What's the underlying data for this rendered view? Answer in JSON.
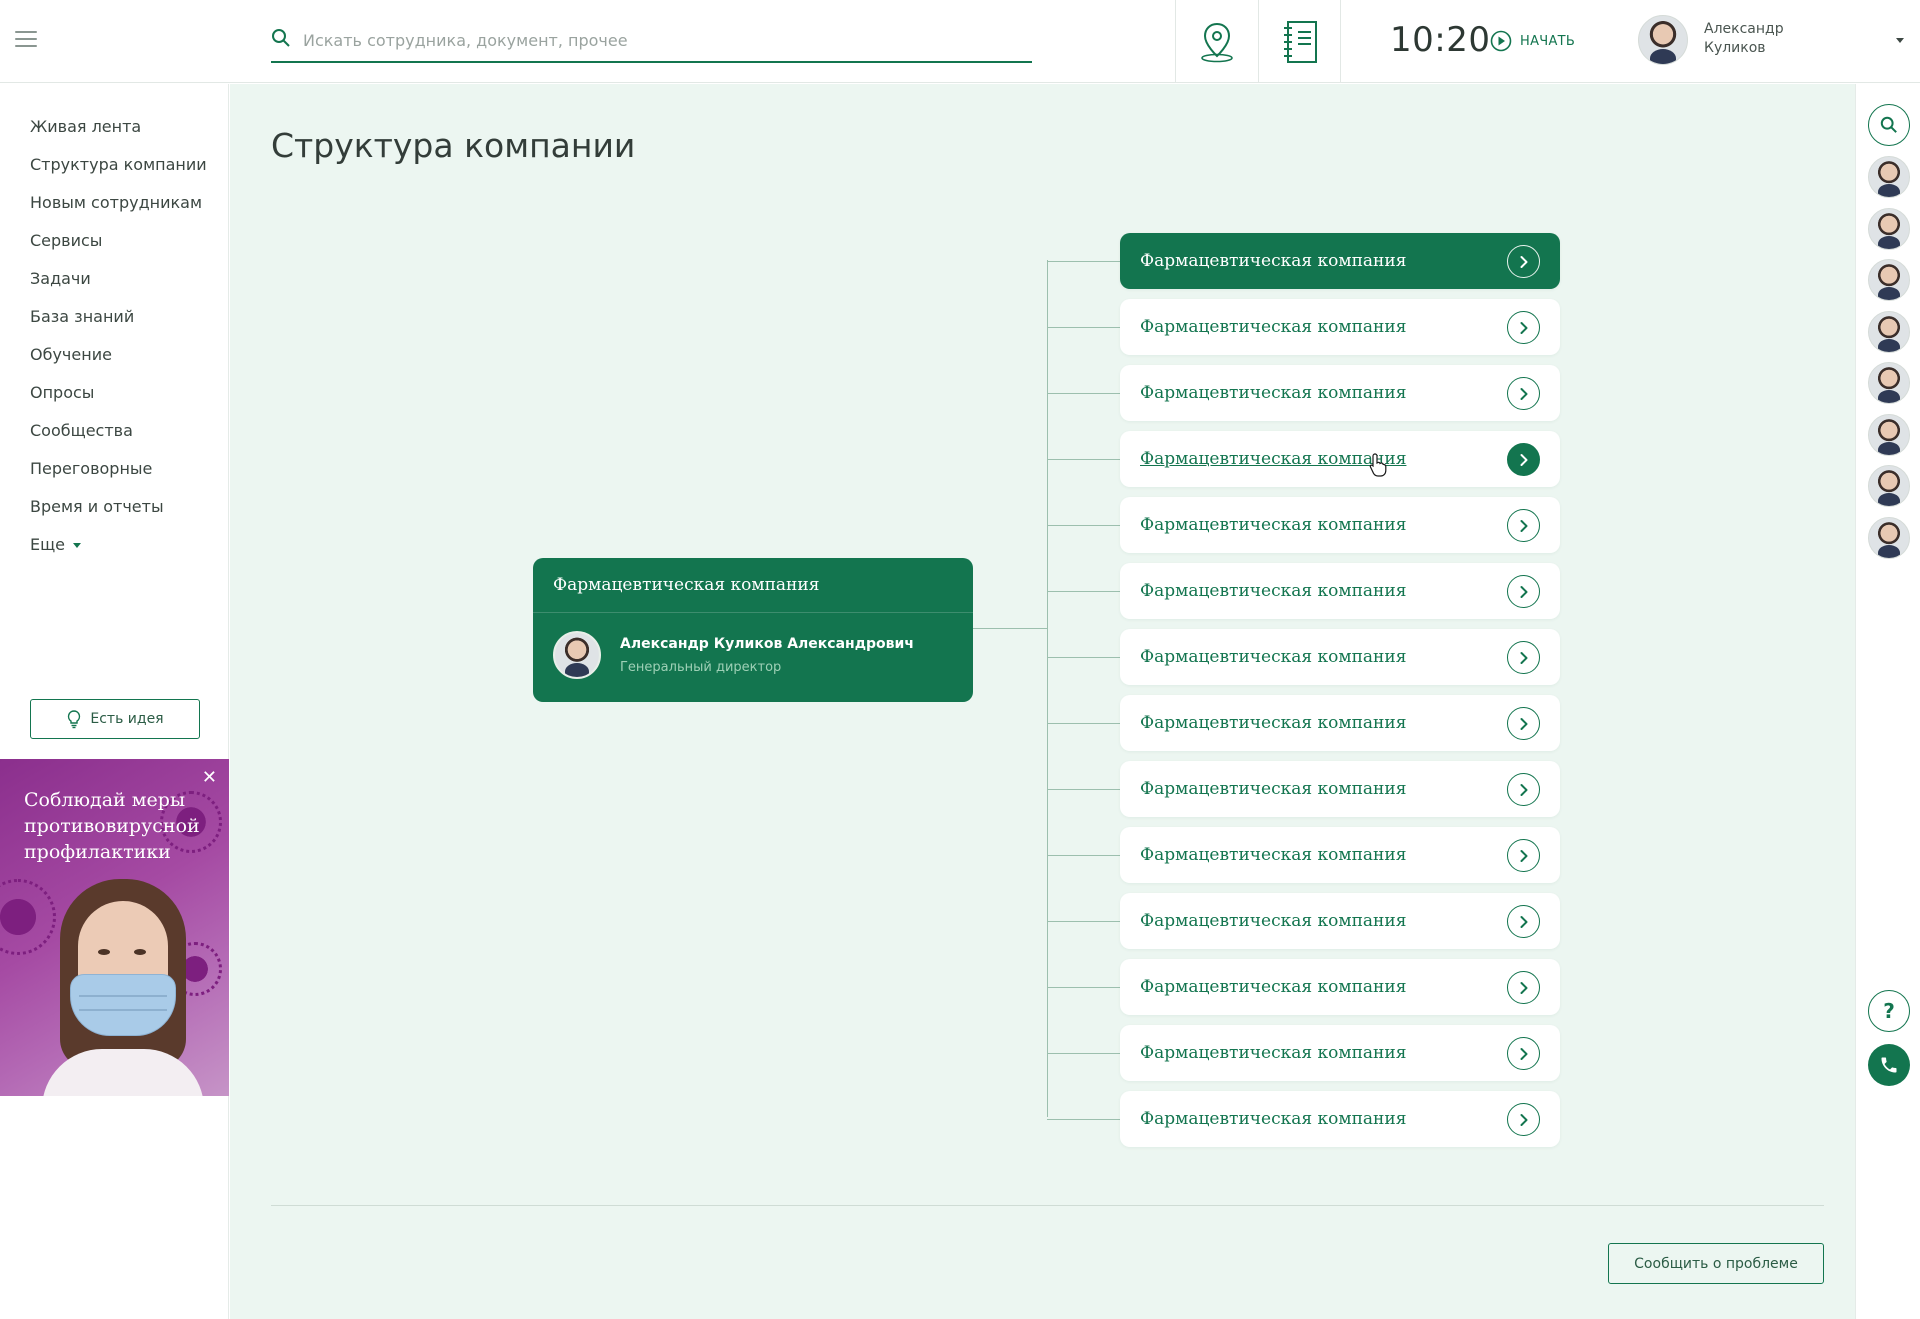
{
  "header": {
    "search_placeholder": "Искать сотрудника, документ, прочее",
    "time": "10:20",
    "start_label": "НАЧАТЬ",
    "user_first_name": "Александр",
    "user_last_name": "Куликов"
  },
  "sidebar": {
    "items": [
      {
        "label": "Живая лента"
      },
      {
        "label": "Структура компании"
      },
      {
        "label": "Новым сотрудникам"
      },
      {
        "label": "Сервисы"
      },
      {
        "label": "Задачи"
      },
      {
        "label": "База знаний"
      },
      {
        "label": "Обучение"
      },
      {
        "label": "Опросы"
      },
      {
        "label": "Сообщества"
      },
      {
        "label": "Переговорные"
      },
      {
        "label": "Время и отчеты"
      }
    ],
    "more_label": "Еще",
    "idea_button": "Есть идея",
    "promo_text": "Соблюдай меры противовирусной профилактики"
  },
  "main": {
    "title": "Структура компании",
    "root": {
      "title": "Фармацевтическая компания",
      "person_name": "Александр Куликов Александрович",
      "person_role": "Генеральный директор"
    },
    "departments": [
      {
        "label": "Фармацевтическая компания",
        "state": "active"
      },
      {
        "label": "Фармацевтическая компания",
        "state": "normal"
      },
      {
        "label": "Фармацевтическая компания",
        "state": "normal"
      },
      {
        "label": "Фармацевтическая компания",
        "state": "hover"
      },
      {
        "label": "Фармацевтическая компания",
        "state": "normal"
      },
      {
        "label": "Фармацевтическая компания",
        "state": "normal"
      },
      {
        "label": "Фармацевтическая компания",
        "state": "normal"
      },
      {
        "label": "Фармацевтическая компания",
        "state": "normal"
      },
      {
        "label": "Фармацевтическая компания",
        "state": "normal"
      },
      {
        "label": "Фармацевтическая компания",
        "state": "normal"
      },
      {
        "label": "Фармацевтическая компания",
        "state": "normal"
      },
      {
        "label": "Фармацевтическая компания",
        "state": "normal"
      },
      {
        "label": "Фармацевтическая компания",
        "state": "normal"
      },
      {
        "label": "Фармацевтическая компания",
        "state": "normal"
      }
    ],
    "report_button": "Сообщить о проблеме"
  },
  "rail": {
    "contacts_count": 8
  },
  "colors": {
    "accent": "#13754f",
    "background": "#ecf6f1",
    "promo": "#a54aa3"
  },
  "icons": [
    "menu-icon",
    "search-icon",
    "map-pin-icon",
    "notebook-icon",
    "play-icon",
    "chevron-down-icon",
    "lightbulb-icon",
    "close-icon",
    "chevron-right-icon",
    "help-icon",
    "phone-icon"
  ]
}
